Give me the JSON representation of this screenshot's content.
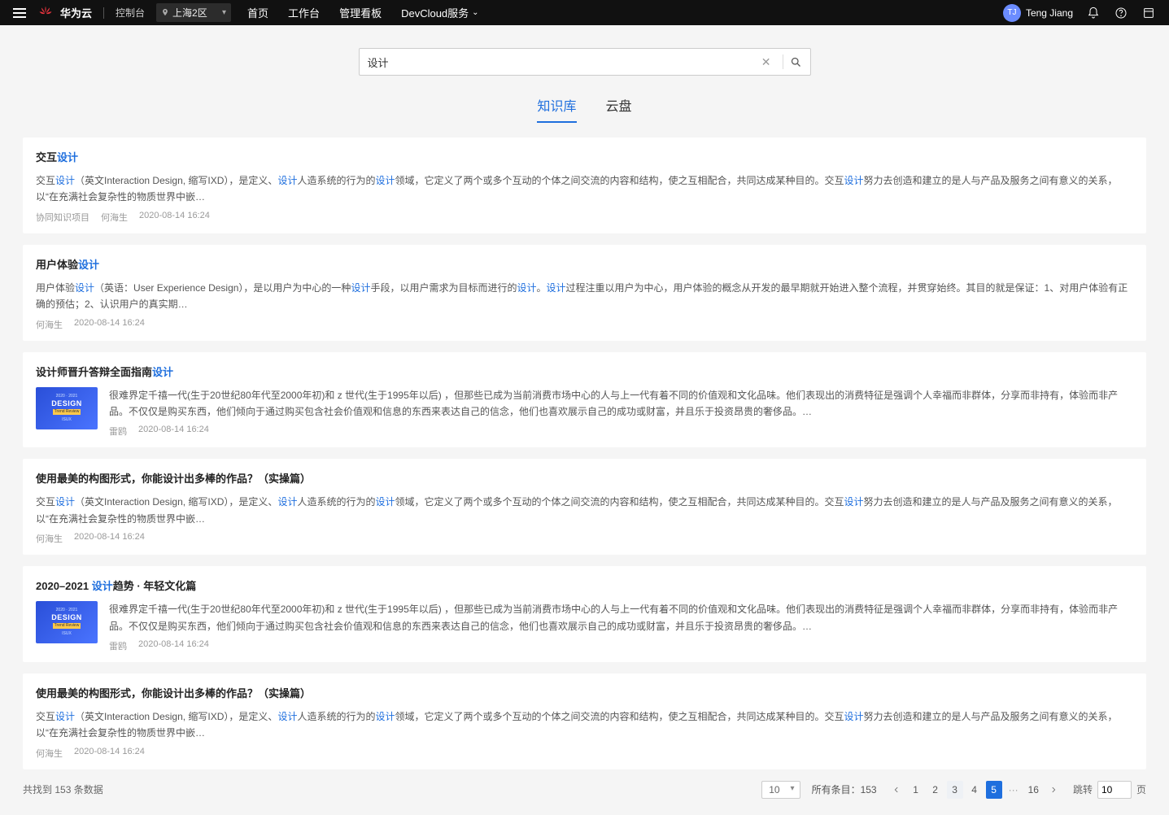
{
  "nav": {
    "brand": "华为云",
    "console": "控制台",
    "region": "上海2区",
    "links": {
      "home": "首页",
      "workspace": "工作台",
      "dashboard": "管理看板",
      "services": "DevCloud服务"
    },
    "user": {
      "initials": "TJ",
      "name": "Teng Jiang"
    }
  },
  "search": {
    "value": "设计",
    "keyword": "设计"
  },
  "tabs": {
    "kb": "知识库",
    "cloud": "云盘"
  },
  "results": [
    {
      "title_parts": [
        "交互",
        "设计"
      ],
      "snippet_parts": [
        "交互",
        "设计",
        "（英文Interaction Design, 缩写IXD），是定义、",
        "设计",
        "人造系统的行为的",
        "设计",
        "领域，它定义了两个或多个互动的个体之间交流的内容和结构，使之互相配合，共同达成某种目的。交互",
        "设计",
        "努力去创造和建立的是人与产品及服务之间有意义的关系，以“在充满社会复杂性的物质世界中嵌…"
      ],
      "meta": [
        "协同知识项目",
        "何海生",
        "2020-08-14 16:24"
      ],
      "has_thumb": false
    },
    {
      "title_parts": [
        "用户体验",
        "设计"
      ],
      "snippet_parts": [
        "用户体验",
        "设计",
        "（英语：User Experience Design），是以用户为中心的一种",
        "设计",
        "手段，以用户需求为目标而进行的",
        "设计",
        "。",
        "设计",
        "过程注重以用户为中心，用户体验的概念从开发的最早期就开始进入整个流程，并贯穿始终。其目的就是保证：1、对用户体验有正确的预估；2、认识用户的真实期…"
      ],
      "meta": [
        "何海生",
        "2020-08-14 16:24"
      ],
      "has_thumb": false
    },
    {
      "title_parts": [
        "设计师晋升答辩全面指南",
        "设计"
      ],
      "snippet_parts": [
        "很难界定千禧一代(生于20世纪80年代至2000年初)和 z 世代(生于1995年以后) ，但那些已成为当前消费市场中心的人与上一代有着不同的价值观和文化品味。他们表现出的消费特征是强调个人幸福而非群体，分享而非持有，体验而非产品。不仅仅是购买东西，他们倾向于通过购买包含社会价值观和信息的东西来表达自己的信念，他们也喜欢展示自己的成功或财富，并且乐于投资昂贵的奢侈品。…"
      ],
      "meta": [
        "雷鸥",
        "2020-08-14 16:24"
      ],
      "has_thumb": true
    },
    {
      "title_parts": [
        "使用最美的构图形式，你能设计出多棒的作品？（实操篇）"
      ],
      "snippet_parts": [
        "交互",
        "设计",
        "（英文Interaction Design, 缩写IXD），是定义、",
        "设计",
        "人造系统的行为的",
        "设计",
        "领域，它定义了两个或多个互动的个体之间交流的内容和结构，使之互相配合，共同达成某种目的。交互",
        "设计",
        "努力去创造和建立的是人与产品及服务之间有意义的关系，以“在充满社会复杂性的物质世界中嵌…"
      ],
      "meta": [
        "何海生",
        "2020-08-14 16:24"
      ],
      "has_thumb": false
    },
    {
      "title_parts": [
        "2020–2021 ",
        "设计",
        "趋势 · 年轻文化篇"
      ],
      "snippet_parts": [
        "很难界定千禧一代(生于20世纪80年代至2000年初)和 z 世代(生于1995年以后) ，但那些已成为当前消费市场中心的人与上一代有着不同的价值观和文化品味。他们表现出的消费特征是强调个人幸福而非群体，分享而非持有，体验而非产品。不仅仅是购买东西，他们倾向于通过购买包含社会价值观和信息的东西来表达自己的信念，他们也喜欢展示自己的成功或财富，并且乐于投资昂贵的奢侈品。…"
      ],
      "meta": [
        "雷鸥",
        "2020-08-14 16:24"
      ],
      "has_thumb": true
    },
    {
      "title_parts": [
        "使用最美的构图形式，你能设计出多棒的作品？（实操篇）"
      ],
      "snippet_parts": [
        "交互",
        "设计",
        "（英文Interaction Design, 缩写IXD），是定义、",
        "设计",
        "人造系统的行为的",
        "设计",
        "领域，它定义了两个或多个互动的个体之间交流的内容和结构，使之互相配合，共同达成某种目的。交互",
        "设计",
        "努力去创造和建立的是人与产品及服务之间有意义的关系，以“在充满社会复杂性的物质世界中嵌…"
      ],
      "meta": [
        "何海生",
        "2020-08-14 16:24"
      ],
      "has_thumb": false
    }
  ],
  "thumb": {
    "t1": "2020 · 2021",
    "t2": "DESIGN",
    "t3": "Trend Review",
    "t4": "ISUX"
  },
  "footer": {
    "found_prefix": "共找到 ",
    "found_count": "153",
    "found_suffix": " 条数据",
    "page_size": "10",
    "total_prefix": "所有条目：",
    "total": "153",
    "pages": [
      "1",
      "2",
      "3",
      "4",
      "5"
    ],
    "last_page": "16",
    "current": "5",
    "hover": "3",
    "jump_label": "跳转",
    "jump_value": "10",
    "jump_suffix": "页"
  }
}
